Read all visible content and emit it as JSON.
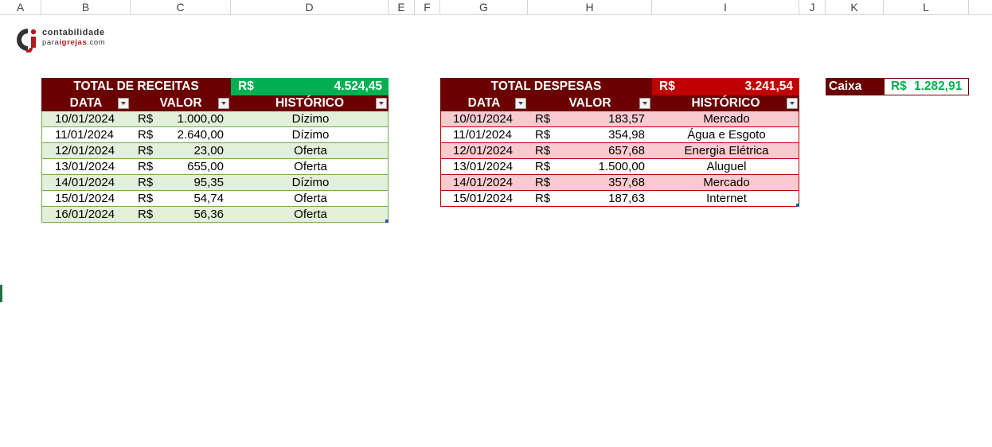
{
  "columns": [
    "A",
    "B",
    "C",
    "D",
    "E",
    "F",
    "G",
    "H",
    "I",
    "J",
    "K",
    "L"
  ],
  "logo": {
    "line1": "contabilidade",
    "line2_a": "para",
    "line2_b": "igrejas",
    "line2_c": ".com"
  },
  "receitas": {
    "title": "TOTAL DE RECEITAS",
    "total_currency": "R$",
    "total_value": "4.524,45",
    "headers": [
      "DATA",
      "VALOR",
      "HISTÓRICO"
    ],
    "rows": [
      {
        "data": "10/01/2024",
        "cur": "R$",
        "valor": "1.000,00",
        "hist": "Dízimo"
      },
      {
        "data": "11/01/2024",
        "cur": "R$",
        "valor": "2.640,00",
        "hist": "Dízimo"
      },
      {
        "data": "12/01/2024",
        "cur": "R$",
        "valor": "23,00",
        "hist": "Oferta"
      },
      {
        "data": "13/01/2024",
        "cur": "R$",
        "valor": "655,00",
        "hist": "Oferta"
      },
      {
        "data": "14/01/2024",
        "cur": "R$",
        "valor": "95,35",
        "hist": "Dízimo"
      },
      {
        "data": "15/01/2024",
        "cur": "R$",
        "valor": "54,74",
        "hist": "Oferta"
      },
      {
        "data": "16/01/2024",
        "cur": "R$",
        "valor": "56,36",
        "hist": "Oferta"
      }
    ],
    "accent": "#00b050"
  },
  "despesas": {
    "title": "TOTAL DESPESAS",
    "total_currency": "R$",
    "total_value": "3.241,54",
    "headers": [
      "DATA",
      "VALOR",
      "HISTÓRICO"
    ],
    "rows": [
      {
        "data": "10/01/2024",
        "cur": "R$",
        "valor": "183,57",
        "hist": "Mercado"
      },
      {
        "data": "11/01/2024",
        "cur": "R$",
        "valor": "354,98",
        "hist": "Água e Esgoto"
      },
      {
        "data": "12/01/2024",
        "cur": "R$",
        "valor": "657,68",
        "hist": "Energia Elétrica"
      },
      {
        "data": "13/01/2024",
        "cur": "R$",
        "valor": "1.500,00",
        "hist": "Aluguel"
      },
      {
        "data": "14/01/2024",
        "cur": "R$",
        "valor": "357,68",
        "hist": "Mercado"
      },
      {
        "data": "15/01/2024",
        "cur": "R$",
        "valor": "187,63",
        "hist": "Internet"
      }
    ],
    "accent": "#c00000"
  },
  "caixa": {
    "label": "Caixa",
    "currency": "R$",
    "value": "1.282,91"
  },
  "colors": {
    "header_dark_red": "#6b0000",
    "green_stripe": "#e2efda",
    "red_stripe": "#f8cbd0"
  }
}
